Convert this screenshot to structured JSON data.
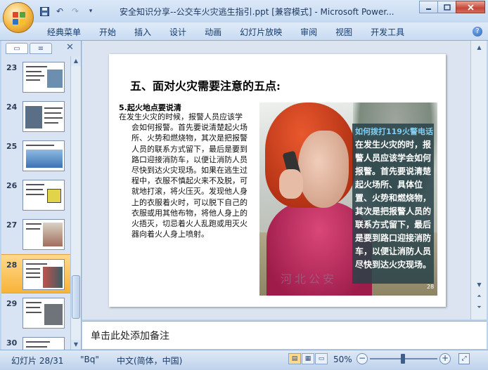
{
  "window": {
    "title": "安全知识分享--公交车火灾逃生指引.ppt [兼容模式] - Microsoft Power..."
  },
  "quick_access": {
    "icons": [
      "save-icon",
      "undo-icon",
      "redo-icon",
      "customize-dropdown-icon"
    ]
  },
  "ribbon": {
    "tabs": [
      "经典菜单",
      "开始",
      "插入",
      "设计",
      "动画",
      "幻灯片放映",
      "审阅",
      "视图",
      "开发工具"
    ]
  },
  "left_pane": {
    "tab_icons": [
      "slides-tab-icon",
      "outline-tab-icon"
    ],
    "close_label": "✕",
    "thumbnails": [
      {
        "number": "23"
      },
      {
        "number": "24"
      },
      {
        "number": "25"
      },
      {
        "number": "26"
      },
      {
        "number": "27"
      },
      {
        "number": "28"
      },
      {
        "number": "29"
      },
      {
        "number": "30"
      }
    ],
    "selected_slide": "28"
  },
  "slide": {
    "title": "五、面对火灾需要注意的五点:",
    "section_heading": "5.起火地点要说清",
    "body": "在发生火灾的时候，报警人员应该学会如何报警。首先要说清楚起火场所、火势和燃烧物，其次是把报警人员的联系方式留下，最后是要到路口迎接消防车，以便让消防人员尽快到达火灾现场。如果在逃生过程中，衣服不慎起火来不及脱，可就地打滚，将火压灭。发现他人身上的衣服着火时，可以脱下自己的衣服或用其他布物，将他人身上的火捂灭，切忌着火人乱跑或用灭火器向着火人身上喷射。",
    "image": {
      "callout_title": "如何拨打119火警电话",
      "callout_text": "在发生火灾的时，报警人员应该学会如何报警。首先要说清楚起火场所、具体位置、火势和燃烧物，其次是把报警人员的联系方式留下，最后是要到路口迎接消防车，以便让消防人员尽快到达火灾现场。",
      "watermark": "河北公安",
      "page_number": "28"
    }
  },
  "notes": {
    "placeholder": "单击此处添加备注"
  },
  "status_bar": {
    "slide_info": "幻灯片 28/31",
    "theme": "\"Bq\"",
    "language": "中文(简体，中国)",
    "zoom": "50%"
  }
}
